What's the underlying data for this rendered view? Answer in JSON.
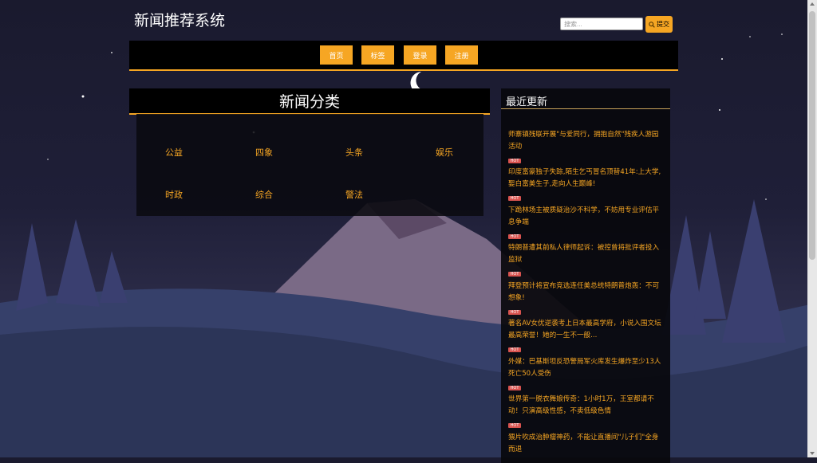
{
  "site": {
    "title": "新闻推荐系统"
  },
  "search": {
    "placeholder": "搜索...",
    "button_label": "提交",
    "button_icon": "search-icon"
  },
  "nav": {
    "items": [
      {
        "label": "首页"
      },
      {
        "label": "标签"
      },
      {
        "label": "登录"
      },
      {
        "label": "注册"
      }
    ]
  },
  "categories": {
    "title": "新闻分类",
    "items": [
      {
        "label": "公益"
      },
      {
        "label": "四象"
      },
      {
        "label": "头条"
      },
      {
        "label": "娱乐"
      },
      {
        "label": "时政"
      },
      {
        "label": "综合"
      },
      {
        "label": "警法"
      }
    ]
  },
  "recent": {
    "title": "最近更新",
    "hot_label": "HOT",
    "items": [
      {
        "text": "师寨镇残联开展\"与爱同行，拥抱自然\"残疾人游园活动"
      },
      {
        "text": "印度富豪独子失踪,陌生乞丐冒名顶替41年:上大学,娶白富美生子,走向人生巅峰!"
      },
      {
        "text": "下跪林场主被质疑治沙不科学，不妨用专业评估平息争端"
      },
      {
        "text": "特朗普遭其前私人律师起诉：被控曾将批评者投入监狱"
      },
      {
        "text": "拜登预计将宣布竞选连任美总统特朗普炮轰：不可想象!"
      },
      {
        "text": "著名AV女优逆袭考上日本最高学府，小说入围文坛最高荣誉！她的一生不一般..."
      },
      {
        "text": "外媒：巴基斯坦反恐警局军火库发生爆炸至少13人死亡50人受伤"
      },
      {
        "text": "世界第一脱衣舞娘传奇：1小时1万，王室都请不动！只演高级性感，不卖低级色情"
      },
      {
        "text": "猥片吹成治肿瘤神药，不能让直播间\"儿子们\"全身而退"
      }
    ]
  },
  "colors": {
    "accent": "#f6a623",
    "hot": "#d9534f"
  }
}
